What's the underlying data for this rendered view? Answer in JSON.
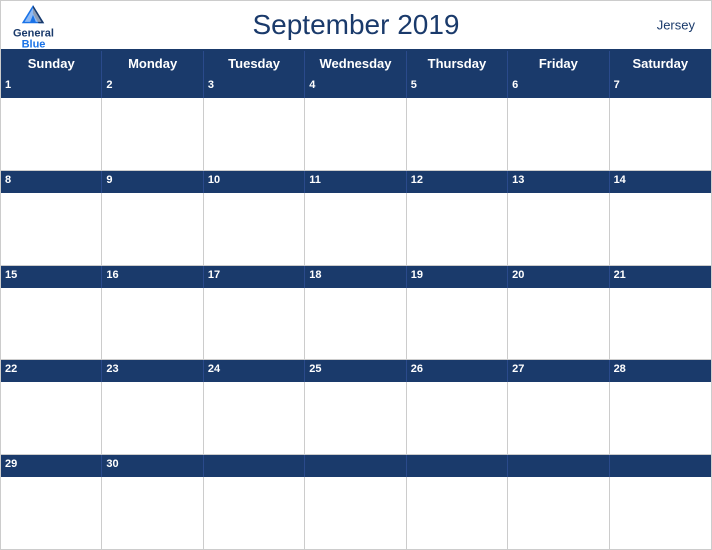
{
  "header": {
    "title": "September 2019",
    "region": "Jersey",
    "logo": {
      "general": "General",
      "blue": "Blue"
    }
  },
  "days": [
    "Sunday",
    "Monday",
    "Tuesday",
    "Wednesday",
    "Thursday",
    "Friday",
    "Saturday"
  ],
  "weeks": [
    {
      "numbers": [
        "1",
        "2",
        "3",
        "4",
        "5",
        "6",
        "7"
      ],
      "empty": [
        false,
        false,
        false,
        false,
        false,
        false,
        false
      ]
    },
    {
      "numbers": [
        "8",
        "9",
        "10",
        "11",
        "12",
        "13",
        "14"
      ],
      "empty": [
        false,
        false,
        false,
        false,
        false,
        false,
        false
      ]
    },
    {
      "numbers": [
        "15",
        "16",
        "17",
        "18",
        "19",
        "20",
        "21"
      ],
      "empty": [
        false,
        false,
        false,
        false,
        false,
        false,
        false
      ]
    },
    {
      "numbers": [
        "22",
        "23",
        "24",
        "25",
        "26",
        "27",
        "28"
      ],
      "empty": [
        false,
        false,
        false,
        false,
        false,
        false,
        false
      ]
    },
    {
      "numbers": [
        "29",
        "30",
        "",
        "",
        "",
        "",
        ""
      ],
      "empty": [
        false,
        false,
        true,
        true,
        true,
        true,
        true
      ]
    }
  ],
  "colors": {
    "headerBg": "#1a3a6b",
    "headerText": "#ffffff",
    "dayNumberColor": "#1a3a6b",
    "borderColor": "#cccccc"
  }
}
